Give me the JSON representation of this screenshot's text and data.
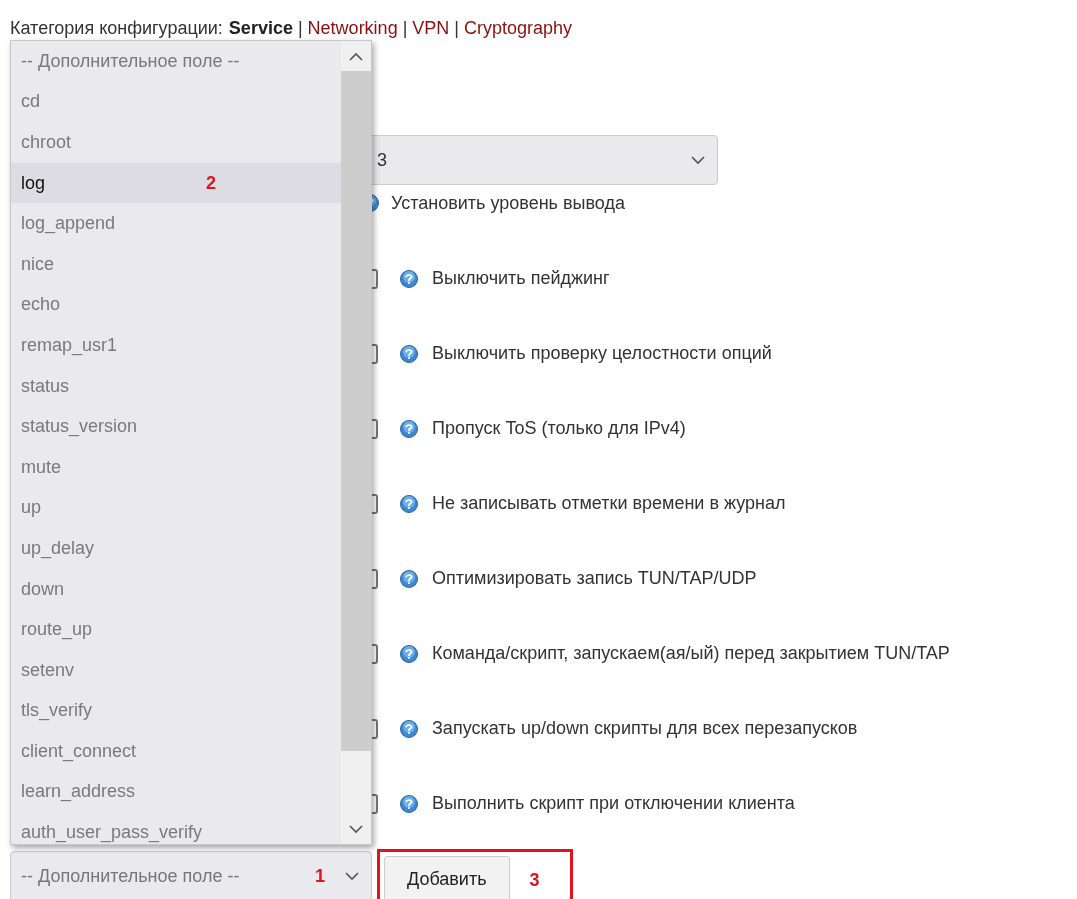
{
  "header": {
    "label": "Категория конфигурации:",
    "separator": "|",
    "items": [
      {
        "text": "Service",
        "selected": true
      },
      {
        "text": "Networking",
        "selected": false
      },
      {
        "text": "VPN",
        "selected": false
      },
      {
        "text": "Cryptography",
        "selected": false
      }
    ]
  },
  "dropdown_list": {
    "items": [
      {
        "label": "-- Дополнительное поле --",
        "selected": false
      },
      {
        "label": "cd",
        "selected": false
      },
      {
        "label": "chroot",
        "selected": false
      },
      {
        "label": "log",
        "selected": true,
        "annotation": "2"
      },
      {
        "label": "log_append",
        "selected": false
      },
      {
        "label": "nice",
        "selected": false
      },
      {
        "label": "echo",
        "selected": false
      },
      {
        "label": "remap_usr1",
        "selected": false
      },
      {
        "label": "status",
        "selected": false
      },
      {
        "label": "status_version",
        "selected": false
      },
      {
        "label": "mute",
        "selected": false
      },
      {
        "label": "up",
        "selected": false
      },
      {
        "label": "up_delay",
        "selected": false
      },
      {
        "label": "down",
        "selected": false
      },
      {
        "label": "route_up",
        "selected": false
      },
      {
        "label": "setenv",
        "selected": false
      },
      {
        "label": "tls_verify",
        "selected": false
      },
      {
        "label": "client_connect",
        "selected": false
      },
      {
        "label": "learn_address",
        "selected": false
      },
      {
        "label": "auth_user_pass_verify",
        "selected": false
      }
    ]
  },
  "level_select": {
    "value": "3"
  },
  "settings": [
    {
      "kind": "text",
      "label": "Установить уровень вывода"
    },
    {
      "kind": "checkbox",
      "label": "Выключить пейджинг",
      "checked": false
    },
    {
      "kind": "checkbox",
      "label": "Выключить проверку целостности опций",
      "checked": false
    },
    {
      "kind": "checkbox",
      "label": "Пропуск ToS (только для IPv4)",
      "checked": false
    },
    {
      "kind": "checkbox",
      "label": "Не записывать отметки времени в журнал",
      "checked": false
    },
    {
      "kind": "checkbox",
      "label": "Оптимизировать запись TUN/TAP/UDP",
      "checked": false
    },
    {
      "kind": "checkbox",
      "label": "Команда/скрипт, запускаем(ая/ый) перед закрытием TUN/TAP",
      "checked": false
    },
    {
      "kind": "checkbox",
      "label": "Запускать up/down скрипты для всех перезапусков",
      "checked": false
    },
    {
      "kind": "checkbox",
      "label": "Выполнить скрипт при отключении клиента",
      "checked": false
    }
  ],
  "field_select": {
    "value": "-- Дополнительное поле --",
    "annotation": "1"
  },
  "add_button": {
    "label": "Добавить",
    "annotation": "3",
    "highlighted": true
  }
}
